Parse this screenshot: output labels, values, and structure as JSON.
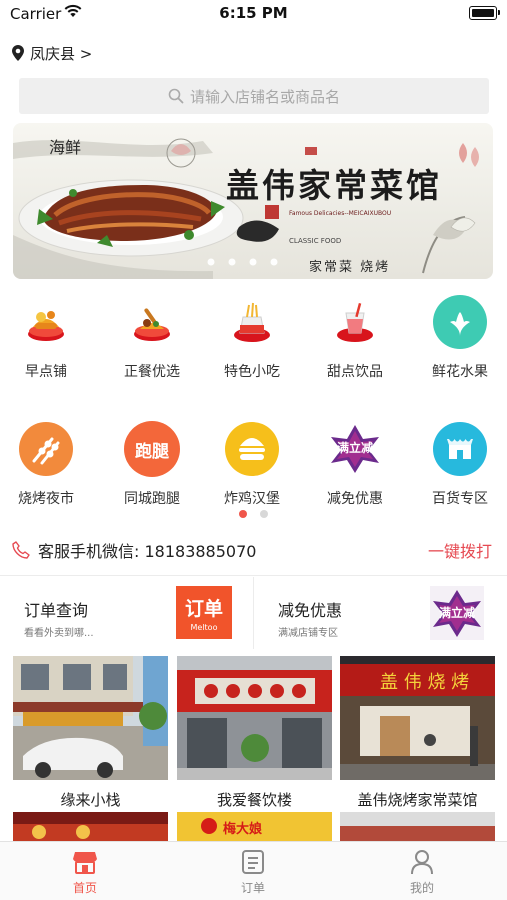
{
  "status": {
    "carrier": "Carrier",
    "time": "6:15 PM"
  },
  "location": {
    "label": "凤庆县 >"
  },
  "search": {
    "placeholder": "请输入店铺名或商品名"
  },
  "banner": {
    "tag": "海鲜",
    "title": "盖伟家常菜馆",
    "subtitle": "Famous Delicacies--MEICAIXUBOU",
    "classic": "CLASSIC FOOD",
    "bottom_line": "家常菜  烧烤",
    "dots": 4
  },
  "categories_row1": [
    {
      "label": "早点铺",
      "icon": "breakfast-icon"
    },
    {
      "label": "正餐优选",
      "icon": "main-meal-icon"
    },
    {
      "label": "特色小吃",
      "icon": "snack-icon"
    },
    {
      "label": "甜点饮品",
      "icon": "dessert-drink-icon"
    },
    {
      "label": "鲜花水果",
      "icon": "flower-fruit-icon"
    }
  ],
  "categories_row2": [
    {
      "label": "烧烤夜市",
      "icon": "bbq-icon"
    },
    {
      "label": "同城跑腿",
      "icon": "errand-icon",
      "badge": "跑腿"
    },
    {
      "label": "炸鸡汉堡",
      "icon": "burger-icon"
    },
    {
      "label": "减免优惠",
      "icon": "discount-icon",
      "badge": "满立减"
    },
    {
      "label": "百货专区",
      "icon": "store-icon"
    }
  ],
  "service": {
    "label": "客服手机微信: 18183885070",
    "action": "一键拨打"
  },
  "promos": [
    {
      "title": "订单查询",
      "sub": "看看外卖到哪...",
      "badge": "订单",
      "badge_sub": "Meltoo"
    },
    {
      "title": "减免优惠",
      "sub": "满减店铺专区",
      "badge": "满立减"
    }
  ],
  "shops": [
    {
      "name": "缘来小栈"
    },
    {
      "name": "我爱餐饮楼"
    },
    {
      "name": "盖伟烧烤家常菜馆"
    }
  ],
  "shops_partial": [
    {
      "label": "梅大娘"
    }
  ],
  "tabs": [
    {
      "label": "首页",
      "active": true
    },
    {
      "label": "订单",
      "active": false
    },
    {
      "label": "我的",
      "active": false
    }
  ],
  "colors": {
    "accent": "#e64a52",
    "tab_active": "#f0564b",
    "tab_inactive": "#8a8a8a"
  }
}
